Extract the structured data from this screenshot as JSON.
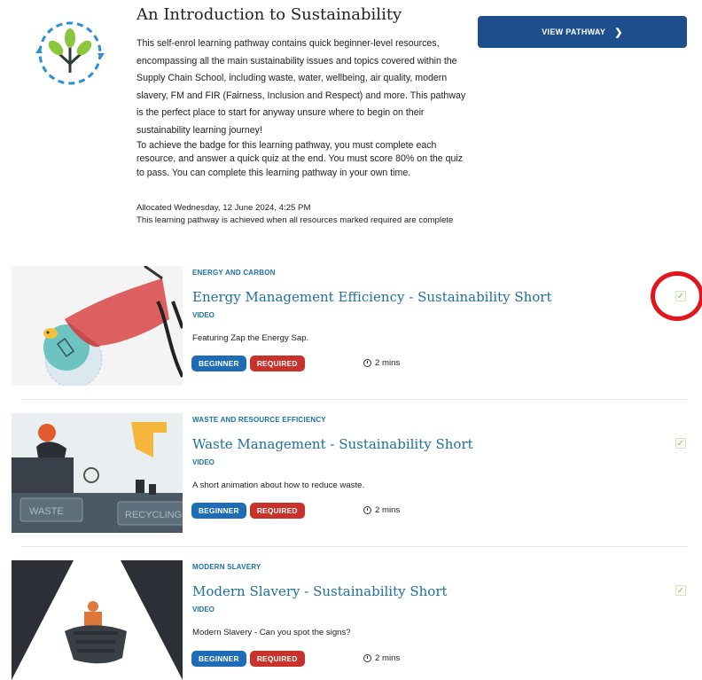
{
  "pathway": {
    "title": "An Introduction to Sustainability",
    "description_1": "This self-enrol learning pathway contains quick beginner-level resources, encompassing all the main sustainability issues and topics covered within the Supply Chain School, including waste, water, wellbeing, air quality, modern slavery, FM and FIR (Fairness, Inclusion and Respect) and more. This pathway is the perfect place to start for anyway unsure where to begin on their sustainability learning journey!",
    "description_2": "To achieve the badge for this learning pathway, you must complete each resource, and answer a quick quiz at the end. You must score 80% on the quiz to pass. You can complete this learning pathway in your own time.",
    "allocated": "Allocated Wednesday, 12 June 2024, 4:25 PM",
    "achievement_note": "This learning pathway is achieved when all resources marked required are complete",
    "view_button": "VIEW PATHWAY",
    "view_button_icon": "chevron-right-icon"
  },
  "resources": [
    {
      "category": "ENERGY AND CARBON",
      "title": "Energy Management Efficiency - Sustainability Short",
      "type": "VIDEO",
      "description": "Featuring Zap the Energy Sap.",
      "badges": [
        "BEGINNER",
        "REQUIRED"
      ],
      "duration": "2 mins",
      "completed": true
    },
    {
      "category": "WASTE AND RESOURCE EFFICIENCY",
      "title": "Waste Management - Sustainability Short",
      "type": "VIDEO",
      "description": "A short animation about how to reduce waste.",
      "badges": [
        "BEGINNER",
        "REQUIRED"
      ],
      "duration": "2 mins",
      "completed": true,
      "thumb_labels": [
        "WASTE",
        "RECYCLING"
      ]
    },
    {
      "category": "MODERN SLAVERY",
      "title": "Modern Slavery - Sustainability Short",
      "type": "VIDEO",
      "description": "Modern Slavery - Can you spot the signs?",
      "badges": [
        "BEGINNER",
        "REQUIRED"
      ],
      "duration": "2 mins",
      "completed": true
    }
  ],
  "colors": {
    "primary_button": "#1d4f8c",
    "beginner_badge": "#1d6cb5",
    "required_badge": "#c8322b",
    "link": "#1f6e9f",
    "check": "#8dc05a",
    "annotation": "#e3151b"
  }
}
